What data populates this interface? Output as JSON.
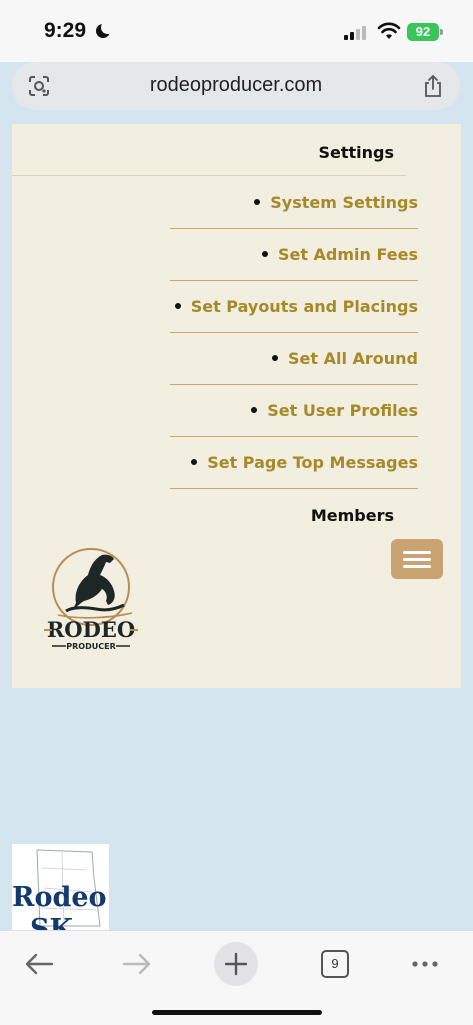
{
  "status": {
    "time": "9:29",
    "battery": "92",
    "icons": [
      "moon-icon",
      "cellular-signal-icon",
      "wifi-icon",
      "battery-icon"
    ]
  },
  "browser": {
    "url": "rodeoproducer.com",
    "tab_count": "9",
    "icons": [
      "lens-icon",
      "share-icon",
      "back-icon",
      "forward-icon",
      "new-tab-icon",
      "tabs-icon",
      "more-icon"
    ]
  },
  "menu": {
    "settings_heading": "Settings",
    "items": [
      {
        "label": "System Settings"
      },
      {
        "label": "Set Admin Fees"
      },
      {
        "label": "Set Payouts and Placings"
      },
      {
        "label": "Set All Around"
      },
      {
        "label": "Set User Profiles"
      },
      {
        "label": "Set Page Top Messages"
      }
    ],
    "members_heading": "Members"
  },
  "logo": {
    "word1": "RODEO",
    "word2": "PRODUCER"
  },
  "thumbnail": {
    "text_line1": "Rodeo",
    "text_line2": "SK"
  },
  "colors": {
    "panel_bg": "#f2efe0",
    "link_gold": "#a6892a",
    "divider": "#caa56f",
    "hamburger_bg": "#c9a472",
    "page_bg": "#d4e5ef"
  }
}
